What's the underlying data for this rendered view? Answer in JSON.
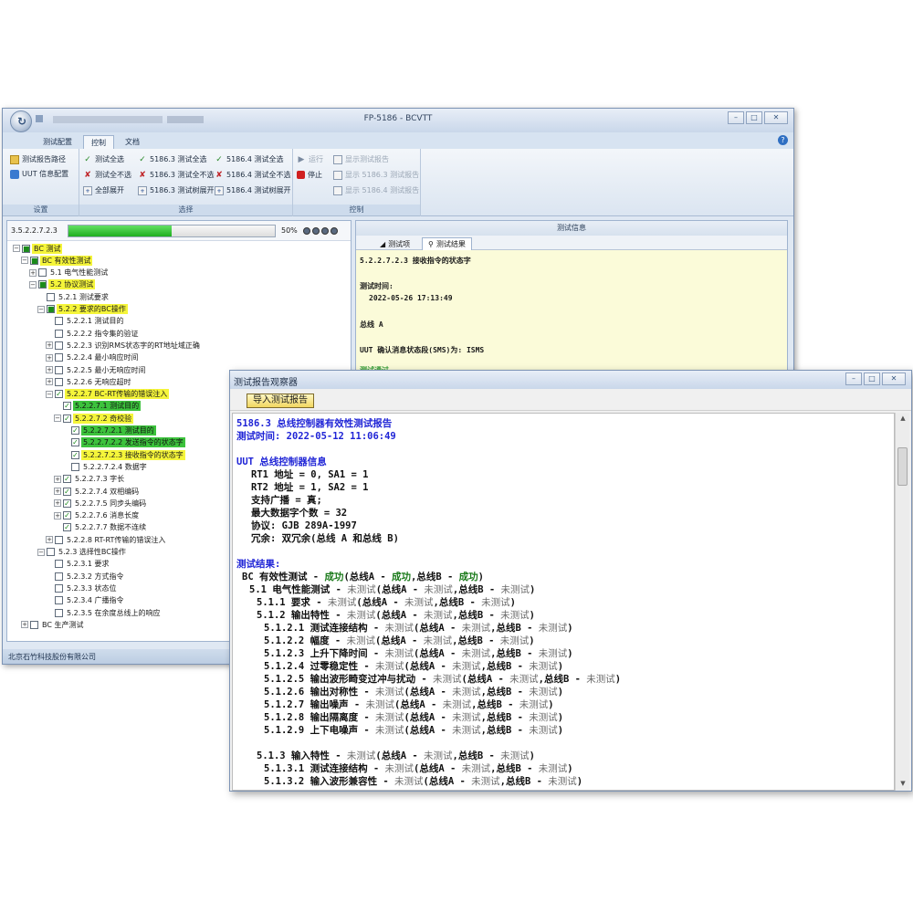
{
  "main": {
    "title": "FP-5186 - BCVTT",
    "tabs": [
      "测试配置",
      "控制",
      "文档"
    ],
    "ribbon": {
      "setup": {
        "title": "设置",
        "report_path": "测试报告路径",
        "uut_config": "UUT 信息配置"
      },
      "select": {
        "title": "选择",
        "col1": [
          "测试全选",
          "测试全不选",
          "全部展开"
        ],
        "col2": [
          "5186.3 测试全选",
          "5186.3 测试全不选",
          "5186.3 测试树展开"
        ],
        "col3": [
          "5186.4 测试全选",
          "5186.4 测试全不选",
          "5186.4 测试树展开"
        ]
      },
      "control": {
        "title": "控制",
        "run": "运行",
        "stop": "停止",
        "show_report": "显示测试报告",
        "show_5186_3": "显示 5186.3 测试报告",
        "show_5186_4": "显示 5186.4 测试报告"
      }
    },
    "progress": {
      "id": "3.5.2.2.7.2.3",
      "percent_label": "50%",
      "value": 0.5
    },
    "tree": [
      {
        "label": "BC 测试",
        "lvl": 0,
        "exp": "−",
        "cb": "■",
        "hl": "yellow"
      },
      {
        "label": "BC 有效性测试",
        "lvl": 1,
        "exp": "−",
        "cb": "■",
        "hl": "yellow"
      },
      {
        "label": "5.1 电气性能测试",
        "lvl": 2,
        "exp": "+",
        "cb": "",
        "hl": ""
      },
      {
        "label": "5.2 协议测试",
        "lvl": 2,
        "exp": "−",
        "cb": "■",
        "hl": "yellow"
      },
      {
        "label": "5.2.1 测试要求",
        "lvl": 3,
        "exp": "",
        "cb": "",
        "hl": ""
      },
      {
        "label": "5.2.2 要求的BC操作",
        "lvl": 3,
        "exp": "−",
        "cb": "■",
        "hl": "yellow"
      },
      {
        "label": "5.2.2.1 测试目的",
        "lvl": 4,
        "exp": "",
        "cb": "",
        "hl": ""
      },
      {
        "label": "5.2.2.2 指令集的验证",
        "lvl": 4,
        "exp": "",
        "cb": "",
        "hl": ""
      },
      {
        "label": "5.2.2.3 识别RMS状态字的RT地址域正确",
        "lvl": 4,
        "exp": "+",
        "cb": "",
        "hl": ""
      },
      {
        "label": "5.2.2.4 最小响应时间",
        "lvl": 4,
        "exp": "+",
        "cb": "",
        "hl": ""
      },
      {
        "label": "5.2.2.5 最小无响应时间",
        "lvl": 4,
        "exp": "+",
        "cb": "",
        "hl": ""
      },
      {
        "label": "5.2.2.6 无响应超时",
        "lvl": 4,
        "exp": "+",
        "cb": "",
        "hl": ""
      },
      {
        "label": "5.2.2.7 BC-RT传输的错误注入",
        "lvl": 4,
        "exp": "−",
        "cb": "✓",
        "hl": "yellow"
      },
      {
        "label": "5.2.2.7.1 测试目的",
        "lvl": 5,
        "exp": "",
        "cb": "✓",
        "hl": "green"
      },
      {
        "label": "5.2.2.7.2 奇校验",
        "lvl": 5,
        "exp": "−",
        "cb": "✓",
        "hl": "yellow"
      },
      {
        "label": "5.2.2.7.2.1 测试目的",
        "lvl": 6,
        "exp": "",
        "cb": "✓",
        "hl": "green"
      },
      {
        "label": "5.2.2.7.2.2 发送指令的状态字",
        "lvl": 6,
        "exp": "",
        "cb": "✓",
        "hl": "green"
      },
      {
        "label": "5.2.2.7.2.3 接收指令的状态字",
        "lvl": 6,
        "exp": "",
        "cb": "✓",
        "hl": "yellow"
      },
      {
        "label": "5.2.2.7.2.4 数据字",
        "lvl": 6,
        "exp": "",
        "cb": "",
        "hl": ""
      },
      {
        "label": "5.2.2.7.3 字长",
        "lvl": 5,
        "exp": "+",
        "cb": "✓",
        "hl": ""
      },
      {
        "label": "5.2.2.7.4 双相编码",
        "lvl": 5,
        "exp": "+",
        "cb": "✓",
        "hl": ""
      },
      {
        "label": "5.2.2.7.5 同步头编码",
        "lvl": 5,
        "exp": "+",
        "cb": "✓",
        "hl": ""
      },
      {
        "label": "5.2.2.7.6 消息长度",
        "lvl": 5,
        "exp": "+",
        "cb": "✓",
        "hl": ""
      },
      {
        "label": "5.2.2.7.7 数据不连续",
        "lvl": 5,
        "exp": "",
        "cb": "✓",
        "hl": ""
      },
      {
        "label": "5.2.2.8 RT-RT传输的错误注入",
        "lvl": 4,
        "exp": "+",
        "cb": "",
        "hl": ""
      },
      {
        "label": "5.2.3 选择性BC操作",
        "lvl": 3,
        "exp": "−",
        "cb": "",
        "hl": ""
      },
      {
        "label": "5.2.3.1 要求",
        "lvl": 4,
        "exp": "",
        "cb": "",
        "hl": ""
      },
      {
        "label": "5.2.3.2 方式指令",
        "lvl": 4,
        "exp": "",
        "cb": "",
        "hl": ""
      },
      {
        "label": "5.2.3.3 状态位",
        "lvl": 4,
        "exp": "",
        "cb": "",
        "hl": ""
      },
      {
        "label": "5.2.3.4 广播指令",
        "lvl": 4,
        "exp": "",
        "cb": "",
        "hl": ""
      },
      {
        "label": "5.2.3.5 在余度总线上的响应",
        "lvl": 4,
        "exp": "",
        "cb": "",
        "hl": ""
      },
      {
        "label": "BC 生产测试",
        "lvl": 1,
        "exp": "+",
        "cb": "",
        "hl": ""
      }
    ],
    "info": {
      "header": "测试信息",
      "tab_items": "测试项",
      "tab_result": "测试结果",
      "lines": [
        "5.2.2.7.2.3 接收指令的状态字",
        "测试时间:",
        "2022-05-26 17:13:49",
        "总线 A",
        "UUT 确认消息状态段(SMS)为: ISMS",
        "测试通过"
      ]
    },
    "status_text": "北京石竹科技股份有限公司"
  },
  "report": {
    "title": "测试报告观察器",
    "import_label": "导入测试报告",
    "lines": [
      {
        "t": "5186.3 总线控制器有效性测试报告",
        "c": "blue",
        "x": 4
      },
      {
        "t": "测试时间:   2022-05-12 11:06:49",
        "c": "blue",
        "x": 4
      },
      {
        "t": "",
        "c": "black",
        "x": 4
      },
      {
        "t": "UUT 总线控制器信息",
        "c": "blue",
        "x": 4
      },
      {
        "t": "RT1 地址 = 0, SA1 = 1",
        "c": "black",
        "x": 20
      },
      {
        "t": "RT2 地址 = 1, SA2 = 1",
        "c": "black",
        "x": 20
      },
      {
        "t": "支持广播 = 真;",
        "c": "black",
        "x": 20
      },
      {
        "t": "最大数据字个数 = 32",
        "c": "black",
        "x": 20
      },
      {
        "t": "协议: GJB 289A-1997",
        "c": "black",
        "x": 20
      },
      {
        "t": "冗余: 双冗余(总线 A 和总线 B)",
        "c": "black",
        "x": 20
      },
      {
        "t": "",
        "c": "black",
        "x": 4
      },
      {
        "t": "测试结果:",
        "c": "blue",
        "x": 4
      },
      {
        "segs": [
          [
            "BC 有效性测试 - ",
            "black"
          ],
          [
            "成功",
            "green"
          ],
          [
            "(总线A - ",
            "black"
          ],
          [
            "成功",
            "green"
          ],
          [
            ",总线B - ",
            "black"
          ],
          [
            "成功",
            "green"
          ],
          [
            ")",
            "black"
          ]
        ],
        "x": 10
      },
      {
        "segs": [
          [
            "5.1 电气性能测试 - ",
            "black"
          ],
          [
            "未测试",
            "gray"
          ],
          [
            "(总线A - ",
            "black"
          ],
          [
            "未测试",
            "gray"
          ],
          [
            ",总线B - ",
            "black"
          ],
          [
            "未测试",
            "gray"
          ],
          [
            ")",
            "black"
          ]
        ],
        "x": 18
      },
      {
        "segs": [
          [
            "5.1.1 要求 - ",
            "black"
          ],
          [
            "未测试",
            "gray"
          ],
          [
            "(总线A - ",
            "black"
          ],
          [
            "未测试",
            "gray"
          ],
          [
            ",总线B - ",
            "black"
          ],
          [
            "未测试",
            "gray"
          ],
          [
            ")",
            "black"
          ]
        ],
        "x": 26
      },
      {
        "segs": [
          [
            "5.1.2 输出特性 - ",
            "black"
          ],
          [
            "未测试",
            "gray"
          ],
          [
            "(总线A - ",
            "black"
          ],
          [
            "未测试",
            "gray"
          ],
          [
            ",总线B - ",
            "black"
          ],
          [
            "未测试",
            "gray"
          ],
          [
            ")",
            "black"
          ]
        ],
        "x": 26
      },
      {
        "segs": [
          [
            "5.1.2.1 测试连接结构 - ",
            "black"
          ],
          [
            "未测试",
            "gray"
          ],
          [
            "(总线A - ",
            "black"
          ],
          [
            "未测试",
            "gray"
          ],
          [
            ",总线B - ",
            "black"
          ],
          [
            "未测试",
            "gray"
          ],
          [
            ")",
            "black"
          ]
        ],
        "x": 34
      },
      {
        "segs": [
          [
            "5.1.2.2 幅度 - ",
            "black"
          ],
          [
            "未测试",
            "gray"
          ],
          [
            "(总线A - ",
            "black"
          ],
          [
            "未测试",
            "gray"
          ],
          [
            ",总线B - ",
            "black"
          ],
          [
            "未测试",
            "gray"
          ],
          [
            ")",
            "black"
          ]
        ],
        "x": 34
      },
      {
        "segs": [
          [
            "5.1.2.3 上升下降时间 - ",
            "black"
          ],
          [
            "未测试",
            "gray"
          ],
          [
            "(总线A - ",
            "black"
          ],
          [
            "未测试",
            "gray"
          ],
          [
            ",总线B - ",
            "black"
          ],
          [
            "未测试",
            "gray"
          ],
          [
            ")",
            "black"
          ]
        ],
        "x": 34
      },
      {
        "segs": [
          [
            "5.1.2.4 过零稳定性 - ",
            "black"
          ],
          [
            "未测试",
            "gray"
          ],
          [
            "(总线A - ",
            "black"
          ],
          [
            "未测试",
            "gray"
          ],
          [
            ",总线B - ",
            "black"
          ],
          [
            "未测试",
            "gray"
          ],
          [
            ")",
            "black"
          ]
        ],
        "x": 34
      },
      {
        "segs": [
          [
            "5.1.2.5 输出波形畸变过冲与扰动 - ",
            "black"
          ],
          [
            "未测试",
            "gray"
          ],
          [
            "(总线A - ",
            "black"
          ],
          [
            "未测试",
            "gray"
          ],
          [
            ",总线B - ",
            "black"
          ],
          [
            "未测试",
            "gray"
          ],
          [
            ")",
            "black"
          ]
        ],
        "x": 34
      },
      {
        "segs": [
          [
            "5.1.2.6 输出对称性 - ",
            "black"
          ],
          [
            "未测试",
            "gray"
          ],
          [
            "(总线A - ",
            "black"
          ],
          [
            "未测试",
            "gray"
          ],
          [
            ",总线B - ",
            "black"
          ],
          [
            "未测试",
            "gray"
          ],
          [
            ")",
            "black"
          ]
        ],
        "x": 34
      },
      {
        "segs": [
          [
            "5.1.2.7 输出噪声 - ",
            "black"
          ],
          [
            "未测试",
            "gray"
          ],
          [
            "(总线A - ",
            "black"
          ],
          [
            "未测试",
            "gray"
          ],
          [
            ",总线B - ",
            "black"
          ],
          [
            "未测试",
            "gray"
          ],
          [
            ")",
            "black"
          ]
        ],
        "x": 34
      },
      {
        "segs": [
          [
            "5.1.2.8 输出隔离度 - ",
            "black"
          ],
          [
            "未测试",
            "gray"
          ],
          [
            "(总线A - ",
            "black"
          ],
          [
            "未测试",
            "gray"
          ],
          [
            ",总线B - ",
            "black"
          ],
          [
            "未测试",
            "gray"
          ],
          [
            ")",
            "black"
          ]
        ],
        "x": 34
      },
      {
        "segs": [
          [
            "5.1.2.9 上下电噪声 - ",
            "black"
          ],
          [
            "未测试",
            "gray"
          ],
          [
            "(总线A - ",
            "black"
          ],
          [
            "未测试",
            "gray"
          ],
          [
            ",总线B - ",
            "black"
          ],
          [
            "未测试",
            "gray"
          ],
          [
            ")",
            "black"
          ]
        ],
        "x": 34
      },
      {
        "t": "",
        "c": "black",
        "x": 4
      },
      {
        "segs": [
          [
            "5.1.3 输入特性 - ",
            "black"
          ],
          [
            "未测试",
            "gray"
          ],
          [
            "(总线A - ",
            "black"
          ],
          [
            "未测试",
            "gray"
          ],
          [
            ",总线B - ",
            "black"
          ],
          [
            "未测试",
            "gray"
          ],
          [
            ")",
            "black"
          ]
        ],
        "x": 26
      },
      {
        "segs": [
          [
            "5.1.3.1 测试连接结构 - ",
            "black"
          ],
          [
            "未测试",
            "gray"
          ],
          [
            "(总线A - ",
            "black"
          ],
          [
            "未测试",
            "gray"
          ],
          [
            ",总线B - ",
            "black"
          ],
          [
            "未测试",
            "gray"
          ],
          [
            ")",
            "black"
          ]
        ],
        "x": 34
      },
      {
        "segs": [
          [
            "5.1.3.2 输入波形兼容性 - ",
            "black"
          ],
          [
            "未测试",
            "gray"
          ],
          [
            "(总线A - ",
            "black"
          ],
          [
            "未测试",
            "gray"
          ],
          [
            ",总线B - ",
            "black"
          ],
          [
            "未测试",
            "gray"
          ],
          [
            ")",
            "black"
          ]
        ],
        "x": 34
      }
    ]
  }
}
